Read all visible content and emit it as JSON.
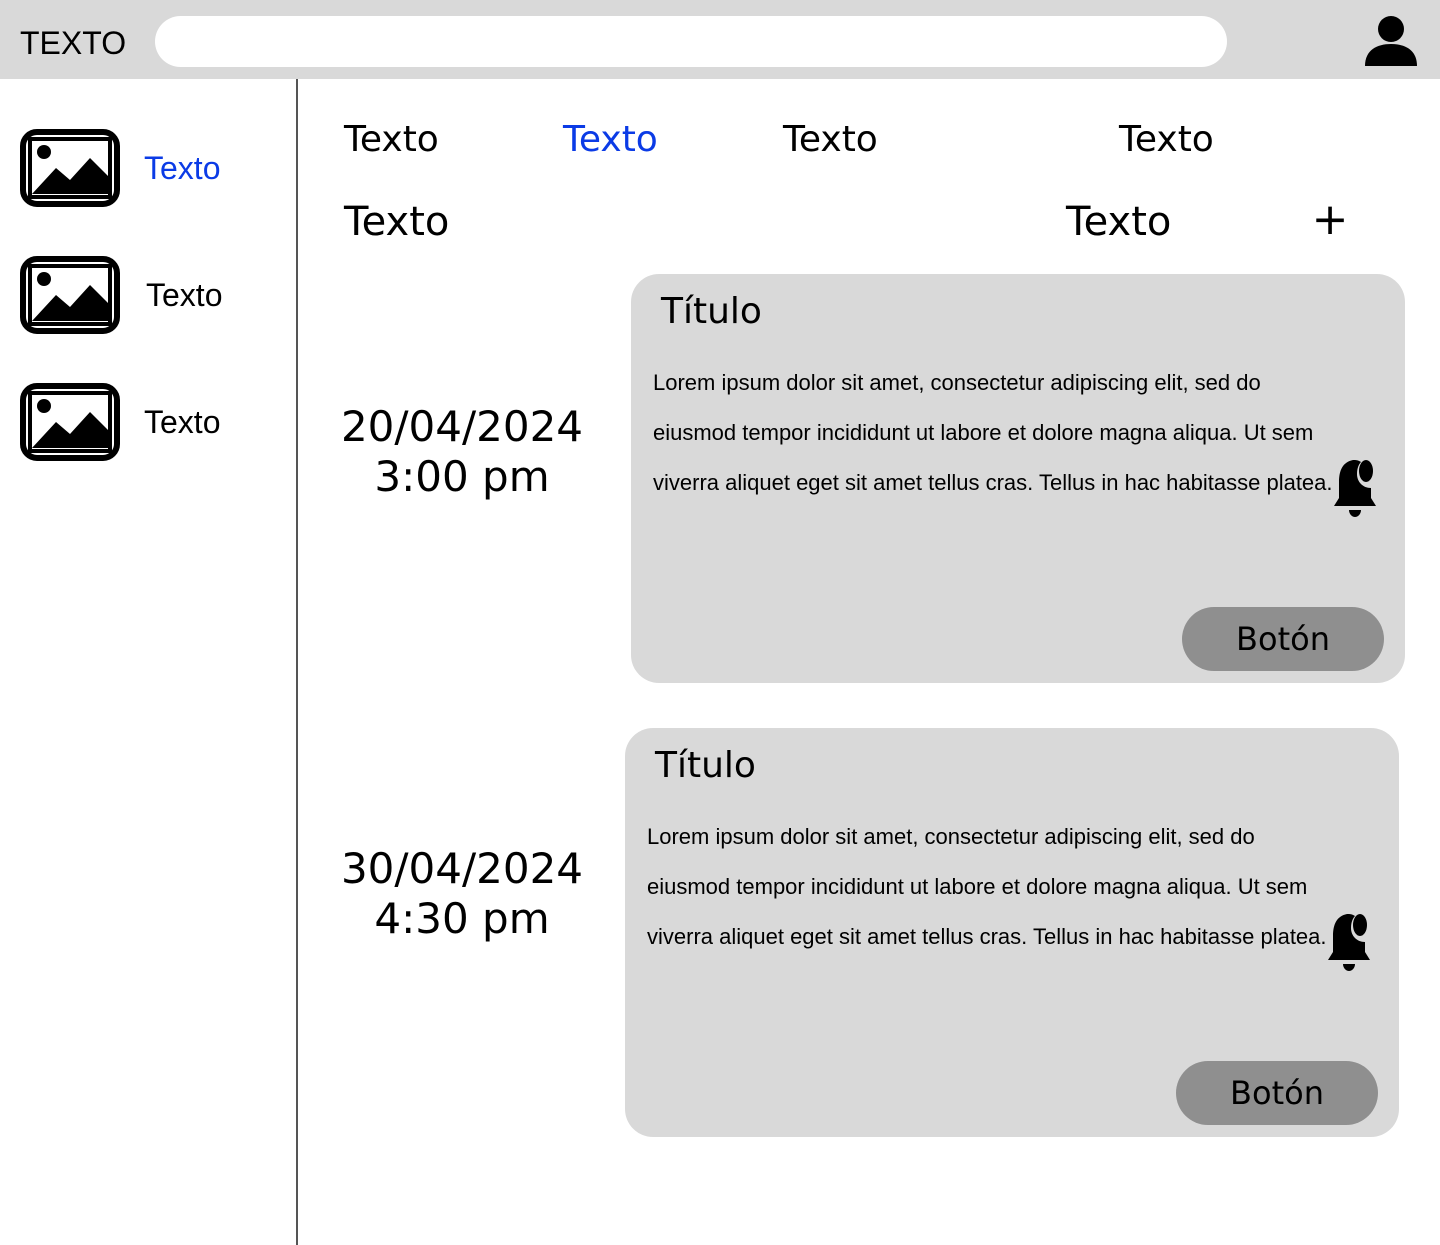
{
  "header": {
    "title": "TEXTO",
    "search_value": "",
    "user_icon": "user-icon"
  },
  "sidebar": {
    "items": [
      {
        "label": "Texto",
        "icon": "image-icon",
        "active": true
      },
      {
        "label": "Texto",
        "icon": "image-icon",
        "active": false
      },
      {
        "label": "Texto",
        "icon": "image-icon",
        "active": false
      }
    ]
  },
  "tabs": [
    {
      "label": "Texto",
      "active": false
    },
    {
      "label": "Texto",
      "active": true
    },
    {
      "label": "Texto",
      "active": false
    },
    {
      "label": "Texto",
      "active": false
    }
  ],
  "subheader": {
    "left_label": "Texto",
    "right_label": "Texto",
    "add_symbol": "+"
  },
  "events": [
    {
      "date": "20/04/2024",
      "time": "3:00 pm",
      "title": "Título",
      "body": "Lorem ipsum dolor sit amet, consectetur adipiscing elit, sed do eiusmod tempor incididunt ut labore et dolore magna aliqua. Ut sem viverra aliquet eget sit amet tellus cras. Tellus in hac habitasse platea.",
      "button_label": "Botón",
      "bell_icon": "bell-icon"
    },
    {
      "date": "30/04/2024",
      "time": "4:30 pm",
      "title": "Título",
      "body": "Lorem ipsum dolor sit amet, consectetur adipiscing elit, sed do eiusmod tempor incididunt ut labore et dolore magna aliqua. Ut sem viverra aliquet eget sit amet tellus cras. Tellus in hac habitasse platea.",
      "button_label": "Botón",
      "bell_icon": "bell-icon"
    }
  ],
  "colors": {
    "accent": "#0b3be6",
    "bar": "#d9d9d9",
    "card": "#d9d9d9",
    "button": "#8f8f8f"
  }
}
